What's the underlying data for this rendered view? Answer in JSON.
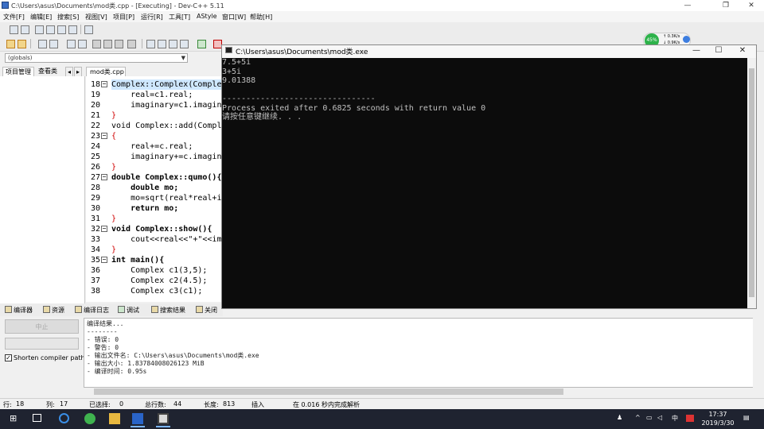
{
  "window": {
    "title": "C:\\Users\\asus\\Documents\\mod类.cpp - [Executing] - Dev-C++ 5.11",
    "controls": {
      "minimize": "—",
      "maximize": "❐",
      "close": "✕"
    }
  },
  "menu": [
    "文件[F]",
    "编辑[E]",
    "搜索[S]",
    "视图[V]",
    "项目[P]",
    "运行[R]",
    "工具[T]",
    "AStyle",
    "窗口[W]",
    "帮助[H]"
  ],
  "toolbar": {
    "globals": "(globals)"
  },
  "left_panel": {
    "tabs": [
      "项目管理",
      "查看类"
    ],
    "nav": [
      "◂",
      "▸"
    ]
  },
  "editor": {
    "file_tab": "mod类.cpp",
    "lines": [
      {
        "n": "18",
        "fold": "−",
        "code": "Complex::Complex(Complex"
      },
      {
        "n": "19",
        "fold": "",
        "code": "    real=c1.real;"
      },
      {
        "n": "20",
        "fold": "",
        "code": "    imaginary=c1.imagina"
      },
      {
        "n": "21",
        "fold": "",
        "code": "}"
      },
      {
        "n": "22",
        "fold": "",
        "code": "void Complex::add(Comple"
      },
      {
        "n": "23",
        "fold": "−",
        "code": "{"
      },
      {
        "n": "24",
        "fold": "",
        "code": "    real+=c.real;"
      },
      {
        "n": "25",
        "fold": "",
        "code": "    imaginary+=c.imagina"
      },
      {
        "n": "26",
        "fold": "",
        "code": "}"
      },
      {
        "n": "27",
        "fold": "−",
        "code": "double Complex::qumo(){"
      },
      {
        "n": "28",
        "fold": "",
        "code": "    double mo;"
      },
      {
        "n": "29",
        "fold": "",
        "code": "    mo=sqrt(real*real+im"
      },
      {
        "n": "30",
        "fold": "",
        "code": "    return mo;"
      },
      {
        "n": "31",
        "fold": "",
        "code": "}"
      },
      {
        "n": "32",
        "fold": "−",
        "code": "void Complex::show(){"
      },
      {
        "n": "33",
        "fold": "",
        "code": "    cout<<real<<\"+\"<<ima"
      },
      {
        "n": "34",
        "fold": "",
        "code": "}"
      },
      {
        "n": "35",
        "fold": "−",
        "code": "int main(){"
      },
      {
        "n": "36",
        "fold": "",
        "code": "    Complex c1(3,5);"
      },
      {
        "n": "37",
        "fold": "",
        "code": "    Complex c2(4.5);"
      },
      {
        "n": "38",
        "fold": "",
        "code": "    Complex c3(c1);"
      }
    ]
  },
  "bottom_tabs": [
    "编译器",
    "资源",
    "编译日志",
    "调试",
    "搜索结果",
    "关闭"
  ],
  "bottom_left": {
    "stop_label": "中止",
    "shorten_label": "Shorten compiler paths",
    "checked": "✓"
  },
  "compile_log": [
    "编译结果...",
    "--------",
    "- 错误: 0",
    "- 警告: 0",
    "- 输出文件名: C:\\Users\\asus\\Documents\\mod类.exe",
    "- 输出大小: 1.83784008026123 MiB",
    "- 编译时间: 0.95s"
  ],
  "status": {
    "row_label": "行:",
    "row": "18",
    "col_label": "列:",
    "col": "17",
    "sel_label": "已选择:",
    "sel": "0",
    "total_label": "总行数:",
    "total": "44",
    "len_label": "长度:",
    "len": "813",
    "mode": "插入",
    "parse": "在 0.016 秒内完成解析"
  },
  "console": {
    "title": "C:\\Users\\asus\\Documents\\mod类.exe",
    "controls": {
      "minimize": "—",
      "maximize": "☐",
      "close": "✕"
    },
    "lines": [
      "7.5+5i",
      "3+5i",
      "9.01388",
      "",
      "--------------------------------",
      "Process exited after 0.6825 seconds with return value 0",
      "请按任意键继续. . ."
    ]
  },
  "perf_widget": {
    "percent": "45%",
    "up": "0.3K/s",
    "down": "0.9K/s"
  },
  "taskbar": {
    "ime": "中",
    "time": "17:37",
    "date": "2019/3/30"
  },
  "colors": {
    "console_bg": "#0c0c0c",
    "console_fg": "#c0c0c0",
    "keyword": "#000000",
    "operator": "#d00000",
    "string": "#1040c0",
    "taskbar": "#1f2330"
  }
}
